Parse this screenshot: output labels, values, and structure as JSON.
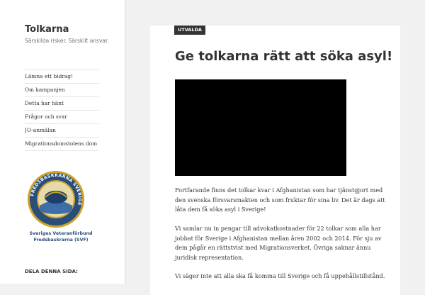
{
  "site": {
    "title": "Tolkarna",
    "description": "Särskilda risker. Särskilt ansvar."
  },
  "nav": {
    "items": [
      {
        "label": "Lämna ett bidrag!"
      },
      {
        "label": "Om kampanjen"
      },
      {
        "label": "Detta har hänt"
      },
      {
        "label": "Frågor och svar"
      },
      {
        "label": "JO-anmälan"
      },
      {
        "label": "Migrationsdomstolens dom"
      }
    ]
  },
  "badge": {
    "ring_text": "FREDSBASKRARNA SVERIGE",
    "caption_line1": "Sveriges Veteranförbund",
    "caption_line2": "Fredsbaskrarna (SVF)"
  },
  "share": {
    "title": "DELA DENNA SIDA:"
  },
  "article": {
    "tag": "UTVALDA",
    "title": "Ge tolkarna rätt att söka asyl!",
    "paragraphs": [
      "Fortfarande finns det tolkar kvar i Afghanistan som har tjänstgjort med den svenska försvarsmakten och som fruktar för sina liv. Det är dags att låta dem få söka asyl i Sverige!",
      "Vi samlar nu in pengar till advokatkostnader för 22 tolkar som alla har jobbat för Sverige i Afghanistan mellan åren 2002 och 2014. För sju av dem pågår en rättstvist med Migrationsverket. Övriga saknar ännu juridisk representation.",
      "Vi säger inte att alla ska få komma till Sverige och få uppehållstillstånd."
    ]
  },
  "colors": {
    "page_bg": "#f1f1f1",
    "sidebar_bg": "#ffffff",
    "tag_bg": "#333333",
    "video_bg": "#000000",
    "badge_gold": "#c9a227",
    "badge_blue": "#2a4d7a"
  }
}
